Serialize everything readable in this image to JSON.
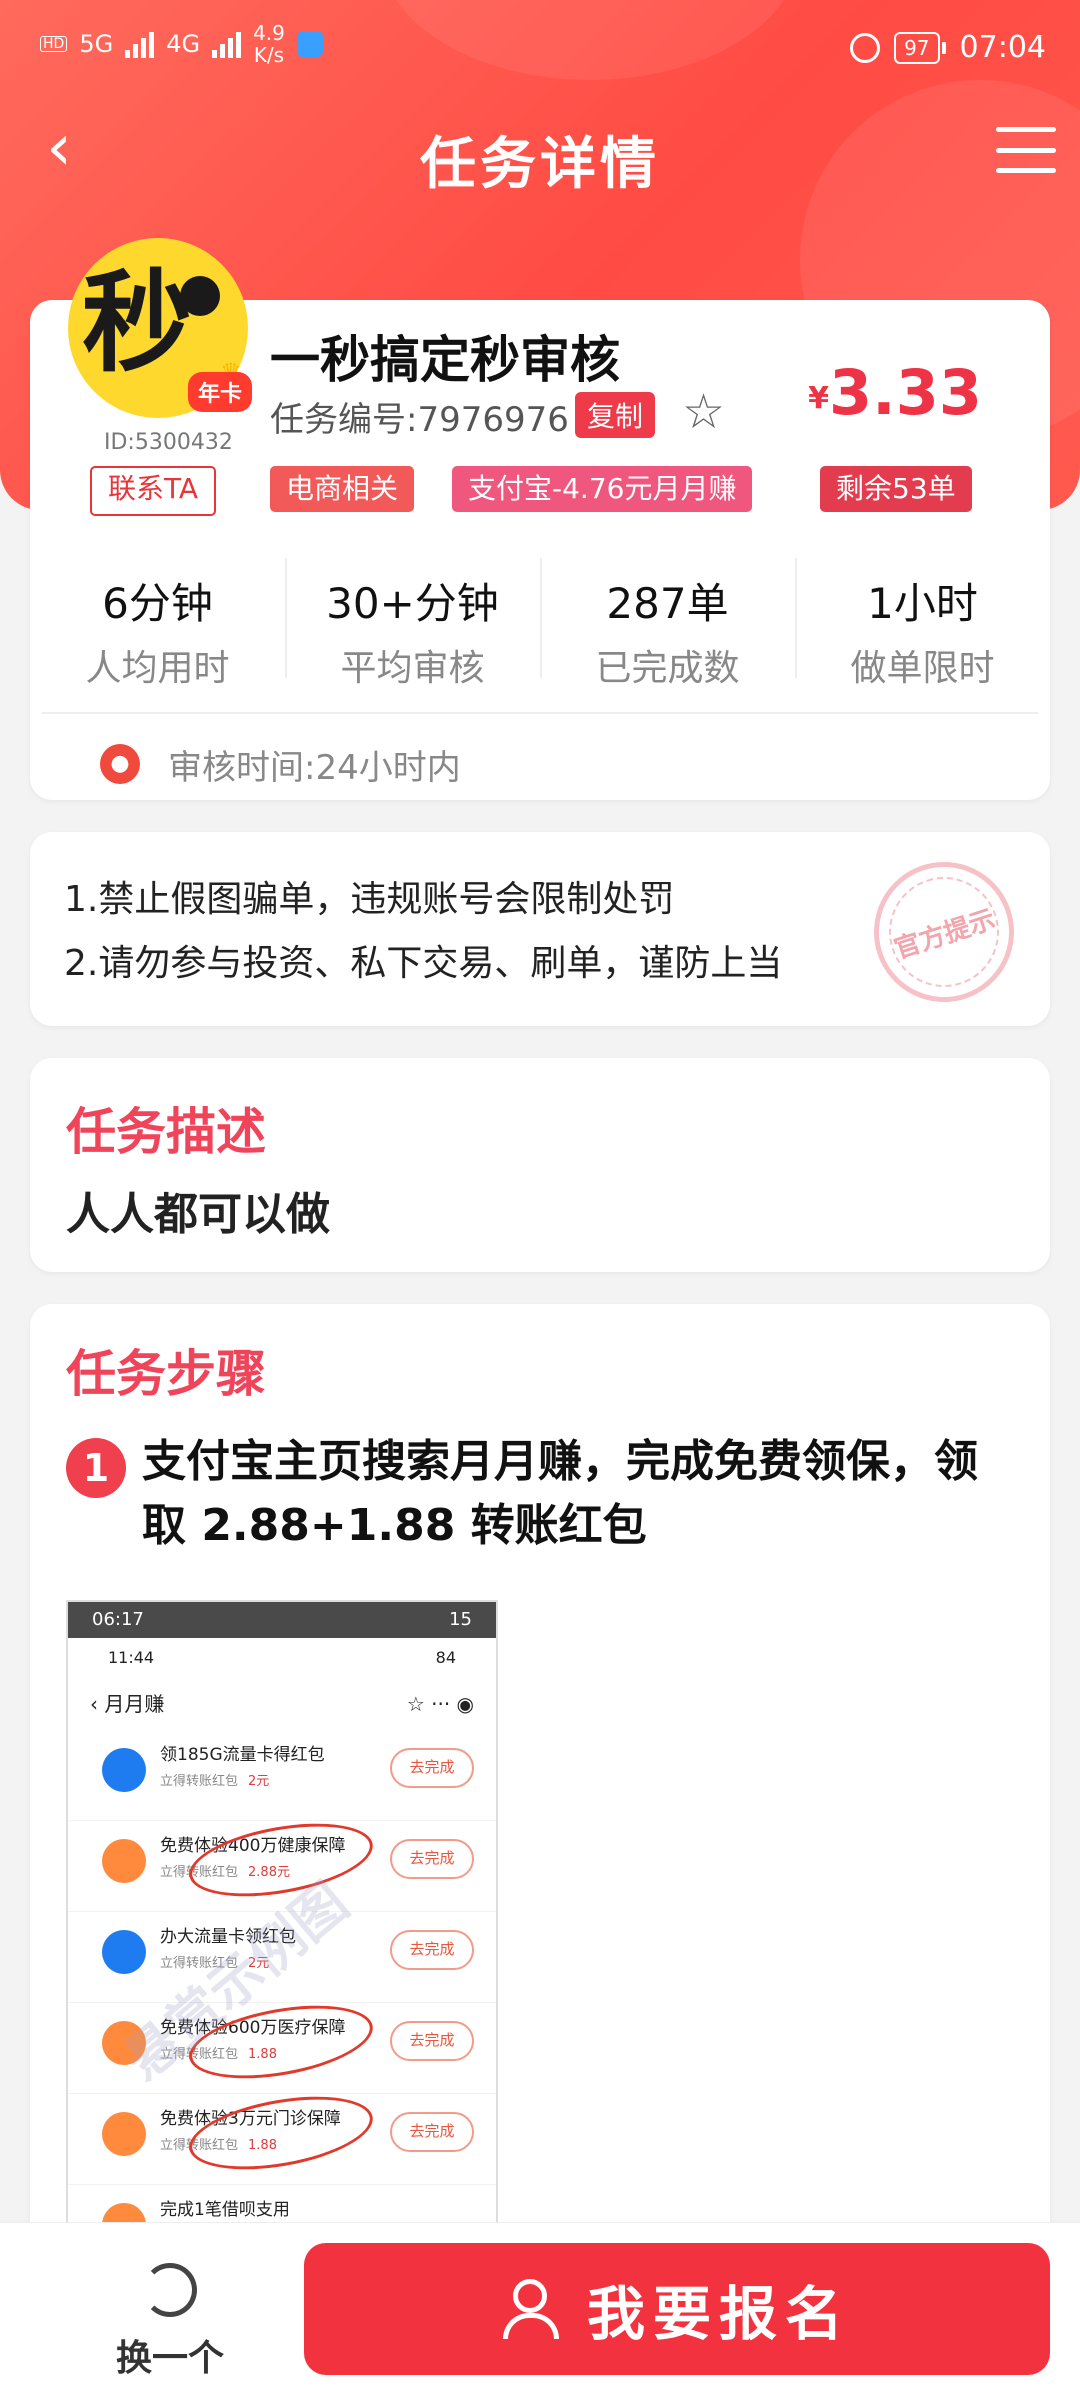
{
  "status_bar": {
    "net1": "5G",
    "net2": "4G",
    "speed_value": "4.9",
    "speed_unit": "K/s",
    "battery": "97",
    "time": "07:04"
  },
  "header": {
    "title": "任务详情"
  },
  "task": {
    "logo_glyph": "秒",
    "badge": "年卡",
    "user_id": "ID:5300432",
    "name": "一秒搞定秒审核",
    "task_no": "任务编号:7976976",
    "copy_label": "复制",
    "currency": "¥",
    "price": "3.33",
    "tags": [
      {
        "label": "联系TA"
      },
      {
        "label": "电商相关"
      },
      {
        "label": "支付宝-4.76元月月赚"
      },
      {
        "label": "剩余53单"
      }
    ],
    "stats": [
      {
        "value": "6分钟",
        "label": "人均用时"
      },
      {
        "value": "30+分钟",
        "label": "平均审核"
      },
      {
        "value": "287单",
        "label": "已完成数"
      },
      {
        "value": "1小时",
        "label": "做单限时"
      }
    ],
    "review_time": "审核时间:24小时内"
  },
  "notice": {
    "line1": "1.禁止假图骗单，违规账号会限制处罚",
    "line2": "2.请勿参与投资、私下交易、刷单，谨防上当",
    "stamp": "官方提示"
  },
  "description": {
    "title": "任务描述",
    "body": "人人都可以做"
  },
  "steps": {
    "title": "任务步骤",
    "items": [
      {
        "number": "1",
        "text": "支付宝主页搜索月月赚，完成免费领保，领取 2.88+1.88 转账红包"
      }
    ],
    "screenshot": {
      "outer_time": "06:17",
      "outer_battery": "15",
      "inner_time": "11:44",
      "inner_battery": "84",
      "nav_title": "月月赚",
      "rows": [
        {
          "title": "领185G流量卡得红包",
          "sub": "立得转账红包",
          "amount": "2元",
          "button": "去完成"
        },
        {
          "title": "免费体验400万健康保障",
          "sub": "立得转账红包",
          "amount": "2.88元",
          "button": "去完成"
        },
        {
          "title": "办大流量卡领红包",
          "sub": "立得转账红包",
          "amount": "2元",
          "button": "去完成"
        },
        {
          "title": "免费体验600万医疗保障",
          "sub": "立得转账红包",
          "amount": "1.88",
          "button": "去完成"
        },
        {
          "title": "免费体验3万元门诊保障",
          "sub": "立得转账红包",
          "amount": "1.88",
          "button": "去完成"
        },
        {
          "title": "完成1笔借呗支用",
          "sub": "",
          "amount": "",
          "button": ""
        }
      ],
      "watermark": "悬赏示例图"
    }
  },
  "bottom": {
    "swap_label": "换一个",
    "signup_label": "我要报名"
  }
}
